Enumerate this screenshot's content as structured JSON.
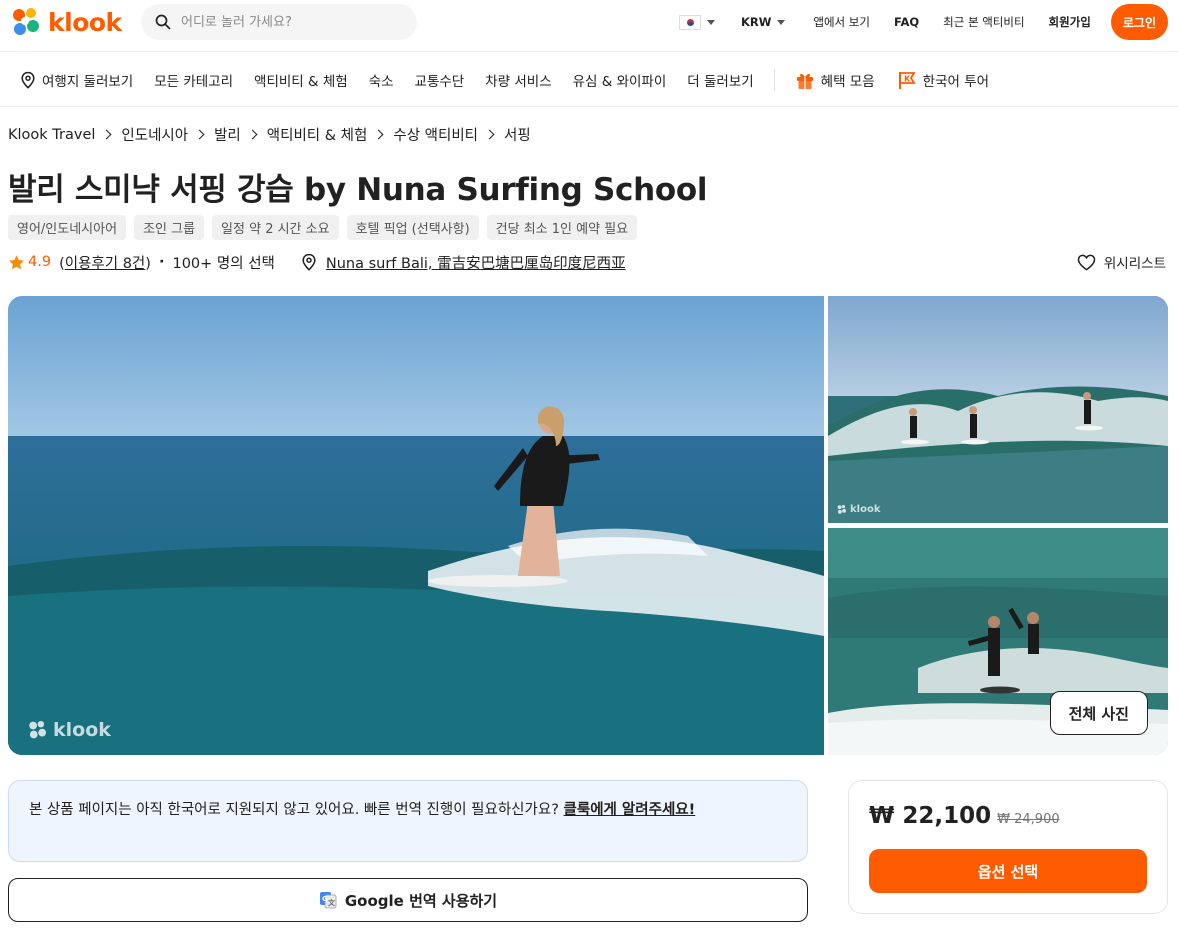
{
  "header": {
    "brand": "klook",
    "search_placeholder": "어디로 놀러 가세요?",
    "currency": "KRW",
    "app_link": "앱에서 보기",
    "faq": "FAQ",
    "recent": "최근 본 액티비티",
    "signup": "회원가입",
    "login": "로그인"
  },
  "nav": {
    "items": [
      {
        "label": "여행지 둘러보기",
        "icon": "map-pin-icon"
      },
      {
        "label": "모든 카테고리"
      },
      {
        "label": "액티비티 & 체험"
      },
      {
        "label": "숙소"
      },
      {
        "label": "교통수단"
      },
      {
        "label": "차량 서비스"
      },
      {
        "label": "유심 & 와이파이"
      },
      {
        "label": "더 둘러보기"
      }
    ],
    "deals": "혜택 모음",
    "korean_tour": "한국어 투어"
  },
  "breadcrumb": [
    "Klook Travel",
    "인도네시아",
    "발리",
    "액티비티 & 체험",
    "수상 액티비티",
    "서핑"
  ],
  "activity": {
    "title": "발리 스미냑 서핑 강습 by Nuna Surfing School",
    "tags": [
      "영어/인도네시아어",
      "조인 그룹",
      "일정 약 2 시간 소요",
      "호텔 픽업 (선택사항)",
      "건당 최소 1인 예약 필요"
    ],
    "rating": "4.9",
    "reviews_prefix": "(",
    "reviews": "이용후기 8건",
    "reviews_suffix": ")",
    "booked": "100+ 명의 선택",
    "location": "Nuna surf Bali, 雷吉安巴塘巴厘岛印度尼西亚",
    "wishlist": "위시리스트"
  },
  "gallery": {
    "watermark": "klook",
    "all_photos": "전체 사진"
  },
  "notice": {
    "text": "본 상품 페이지는 아직 한국어로 지원되지 않고 있어요. 빠른 번역 진행이 필요하신가요? ",
    "link": "클룩에게 알려주세요!"
  },
  "google_translate": "Google 번역 사용하기",
  "booking": {
    "price": "₩ 22,100",
    "original_price": "₩ 24,900",
    "cta": "옵션 선택"
  },
  "colors": {
    "brand": "#ff5b00",
    "notice_bg": "#eef5ff"
  }
}
